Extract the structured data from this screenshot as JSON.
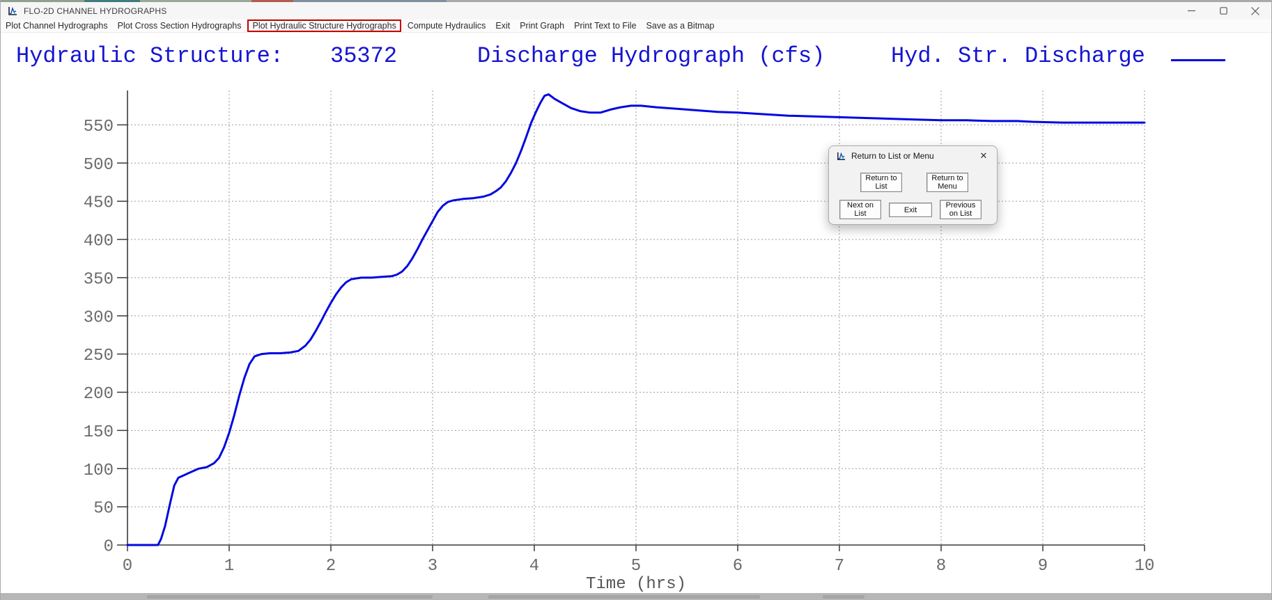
{
  "window": {
    "title": "FLO-2D CHANNEL HYDROGRAPHS"
  },
  "menu": {
    "items": [
      {
        "label": "Plot Channel Hydrographs",
        "highlighted": false
      },
      {
        "label": "Plot Cross Section Hydrographs",
        "highlighted": false
      },
      {
        "label": "Plot Hydraulic Structure Hydrographs",
        "highlighted": true
      },
      {
        "label": "Compute Hydraulics",
        "highlighted": false
      },
      {
        "label": "Exit",
        "highlighted": false
      },
      {
        "label": "Print Graph",
        "highlighted": false
      },
      {
        "label": "Print Text to File",
        "highlighted": false
      },
      {
        "label": "Save as a Bitmap",
        "highlighted": false
      }
    ],
    "highlight_color": "#c40000"
  },
  "header": {
    "structure_label": "Hydraulic Structure:",
    "structure_value": "35372"
  },
  "chart_data": {
    "type": "line",
    "title": "Discharge Hydrograph (cfs)",
    "legend": [
      {
        "label": "Hyd. Str. Discharge",
        "color": "#0008e0",
        "position": "top-right"
      }
    ],
    "xlabel": "Time (hrs)",
    "ylabel": "",
    "xlim": [
      0,
      10
    ],
    "ylim": [
      0,
      595
    ],
    "x_ticks": [
      0,
      1,
      2,
      3,
      4,
      5,
      6,
      7,
      8,
      9,
      10
    ],
    "y_ticks": [
      0,
      50,
      100,
      150,
      200,
      250,
      300,
      350,
      400,
      450,
      500,
      550
    ],
    "grid": "dotted",
    "line_color": "#0008e0",
    "axis_color": "#3a3a3a",
    "tick_label_color": "#6a6a6a",
    "series": [
      {
        "name": "Hyd. Str. Discharge",
        "points": [
          [
            0.0,
            0
          ],
          [
            0.3,
            0
          ],
          [
            0.33,
            8
          ],
          [
            0.37,
            25
          ],
          [
            0.42,
            55
          ],
          [
            0.46,
            78
          ],
          [
            0.5,
            88
          ],
          [
            0.55,
            91
          ],
          [
            0.6,
            94
          ],
          [
            0.65,
            97
          ],
          [
            0.7,
            100
          ],
          [
            0.78,
            102
          ],
          [
            0.85,
            107
          ],
          [
            0.9,
            114
          ],
          [
            0.95,
            128
          ],
          [
            1.0,
            147
          ],
          [
            1.05,
            170
          ],
          [
            1.1,
            196
          ],
          [
            1.15,
            219
          ],
          [
            1.2,
            237
          ],
          [
            1.25,
            247
          ],
          [
            1.32,
            250
          ],
          [
            1.4,
            251
          ],
          [
            1.5,
            251
          ],
          [
            1.6,
            252
          ],
          [
            1.68,
            254
          ],
          [
            1.75,
            261
          ],
          [
            1.8,
            269
          ],
          [
            1.85,
            280
          ],
          [
            1.9,
            292
          ],
          [
            1.95,
            305
          ],
          [
            2.0,
            317
          ],
          [
            2.05,
            328
          ],
          [
            2.1,
            337
          ],
          [
            2.15,
            344
          ],
          [
            2.2,
            348
          ],
          [
            2.3,
            350
          ],
          [
            2.4,
            350
          ],
          [
            2.5,
            351
          ],
          [
            2.6,
            352
          ],
          [
            2.65,
            354
          ],
          [
            2.7,
            358
          ],
          [
            2.75,
            365
          ],
          [
            2.8,
            375
          ],
          [
            2.85,
            387
          ],
          [
            2.9,
            400
          ],
          [
            2.95,
            412
          ],
          [
            3.0,
            424
          ],
          [
            3.05,
            436
          ],
          [
            3.1,
            444
          ],
          [
            3.15,
            449
          ],
          [
            3.2,
            451
          ],
          [
            3.3,
            453
          ],
          [
            3.4,
            454
          ],
          [
            3.5,
            456
          ],
          [
            3.57,
            459
          ],
          [
            3.62,
            463
          ],
          [
            3.67,
            468
          ],
          [
            3.72,
            476
          ],
          [
            3.77,
            487
          ],
          [
            3.82,
            500
          ],
          [
            3.87,
            516
          ],
          [
            3.92,
            534
          ],
          [
            3.97,
            553
          ],
          [
            4.02,
            568
          ],
          [
            4.06,
            579
          ],
          [
            4.1,
            588
          ],
          [
            4.14,
            590
          ],
          [
            4.2,
            584
          ],
          [
            4.28,
            578
          ],
          [
            4.36,
            572
          ],
          [
            4.45,
            568
          ],
          [
            4.55,
            566
          ],
          [
            4.65,
            566
          ],
          [
            4.75,
            570
          ],
          [
            4.85,
            573
          ],
          [
            4.95,
            575
          ],
          [
            5.05,
            575
          ],
          [
            5.2,
            573
          ],
          [
            5.4,
            571
          ],
          [
            5.6,
            569
          ],
          [
            5.8,
            567
          ],
          [
            6.0,
            566
          ],
          [
            6.25,
            564
          ],
          [
            6.5,
            562
          ],
          [
            6.75,
            561
          ],
          [
            7.0,
            560
          ],
          [
            7.25,
            559
          ],
          [
            7.5,
            558
          ],
          [
            7.75,
            557
          ],
          [
            8.0,
            556
          ],
          [
            8.25,
            556
          ],
          [
            8.5,
            555
          ],
          [
            8.75,
            555
          ],
          [
            8.9,
            554
          ],
          [
            9.2,
            553
          ],
          [
            9.6,
            553
          ],
          [
            10.0,
            553
          ]
        ]
      }
    ]
  },
  "dialog": {
    "title": "Return to List or Menu",
    "close_glyph": "✕",
    "buttons": [
      {
        "label": "Return to\nList"
      },
      {
        "label": "Return to\nMenu"
      },
      {
        "label": "Next on\nList"
      },
      {
        "label": "Exit"
      },
      {
        "label": "Previous\non List"
      }
    ]
  }
}
